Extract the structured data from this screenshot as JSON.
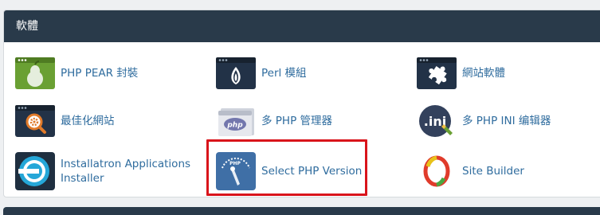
{
  "section": {
    "title": "軟體"
  },
  "items": [
    {
      "label": "PHP PEAR 封裝",
      "icon": "pear-package-icon"
    },
    {
      "label": "Perl 模組",
      "icon": "perl-onion-icon"
    },
    {
      "label": "網站軟體",
      "icon": "puzzle-piece-icon"
    },
    {
      "label": "最佳化網站",
      "icon": "magnifier-gear-icon"
    },
    {
      "label": "多 PHP 管理器",
      "icon": "php-logo-icon"
    },
    {
      "label": "多 PHP INI 编辑器",
      "icon": "ini-file-icon"
    },
    {
      "label": "Installatron Applications Installer",
      "icon": "installatron-icon"
    },
    {
      "label": "Select PHP Version",
      "icon": "php-gauge-icon"
    },
    {
      "label": "Site Builder",
      "icon": "site-builder-icon"
    }
  ],
  "colors": {
    "header": "#293a4a",
    "link": "#2f6c9e",
    "highlight": "#d9141b"
  }
}
